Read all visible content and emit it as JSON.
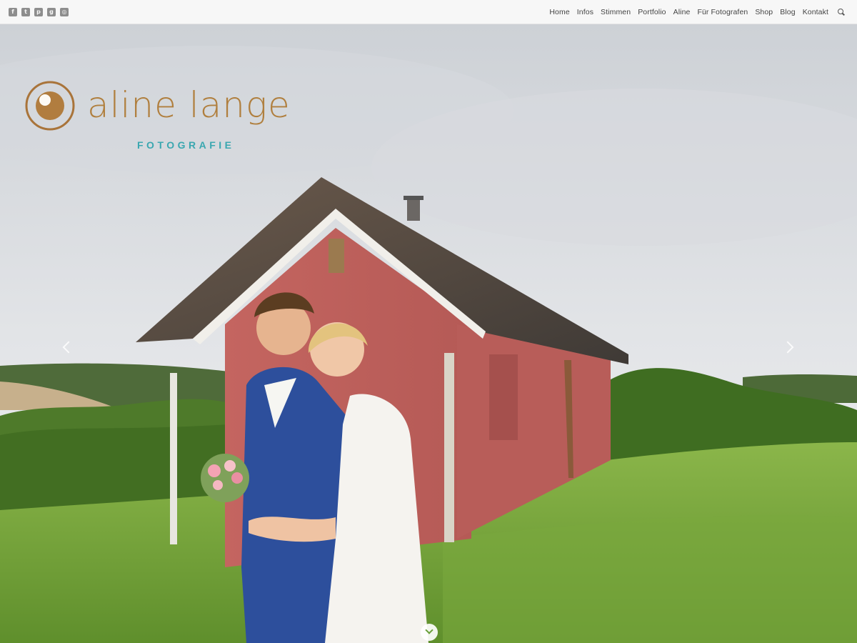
{
  "social": [
    {
      "name": "facebook-icon",
      "glyph": "f"
    },
    {
      "name": "twitter-icon",
      "glyph": "t"
    },
    {
      "name": "pinterest-icon",
      "glyph": "p"
    },
    {
      "name": "google-plus-icon",
      "glyph": "g"
    },
    {
      "name": "instagram-icon",
      "glyph": "◎"
    }
  ],
  "nav": {
    "home": "Home",
    "infos": "Infos",
    "stimmen": "Stimmen",
    "portfolio": "Portfolio",
    "aline": "Aline",
    "fotografen": "Für Fotografen",
    "shop": "Shop",
    "blog": "Blog",
    "kontakt": "Kontakt"
  },
  "logo": {
    "name": "aline lange",
    "subtitle": "FOTOGRAFIE"
  },
  "colors": {
    "brand_gold": "#b07f3e",
    "brand_teal": "#3aa7b0",
    "accent_green": "#6aa03a"
  },
  "icons": {
    "prev": "chevron-left-icon",
    "next": "chevron-right-icon",
    "scroll": "chevron-down-icon",
    "search": "search-icon"
  }
}
